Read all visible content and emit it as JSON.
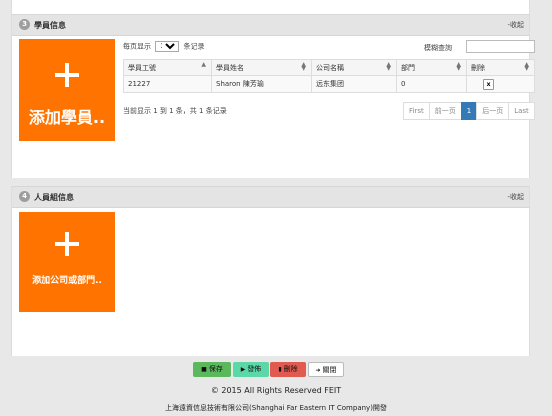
{
  "students_panel": {
    "number": "3",
    "title": "學員信息",
    "collapse": "-收起",
    "add_tile_label": "添加學員..",
    "page_size_prefix": "每页显示",
    "page_size_value": "10",
    "page_size_suffix": "条记录",
    "search_label": "模糊查詢",
    "search_value": "",
    "columns": [
      "學員工號",
      "學員姓名",
      "公司名稱",
      "部門",
      "刪除"
    ],
    "rows": [
      {
        "id": "21227",
        "name": "Sharon 陳芳瑜",
        "company": "远东集团",
        "dept": "0",
        "delete_icon": "x"
      }
    ],
    "info": "当前显示 1 到 1 条，共 1 条记录",
    "pagination": [
      "First",
      "前一页",
      "1",
      "后一页",
      "Last"
    ]
  },
  "personnel_panel": {
    "number": "4",
    "title": "人員組信息",
    "collapse": "-收起",
    "add_tile_label": "添加公司或部門.."
  },
  "actions": {
    "save": "保存",
    "publish": "發佈",
    "delete": "刪除",
    "close": "關閉"
  },
  "footer": {
    "copyright": "© 2015 All Rights Reserved FEIT",
    "company": "上海遠資信息技術有限公司(Shanghai Far Eastern IT Company)開發"
  },
  "colors": {
    "tile": "#ff7400",
    "active_page": "#337ab7",
    "save": "#5cb85c",
    "publish": "#5cd7a8",
    "delete": "#e05a4f"
  }
}
